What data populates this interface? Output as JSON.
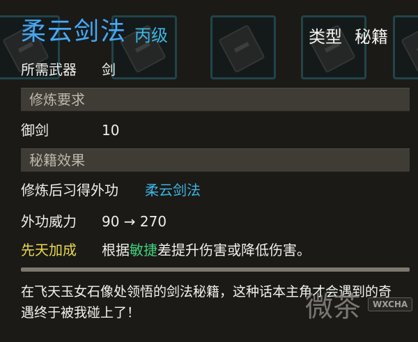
{
  "item": {
    "name": "柔云剑法",
    "grade": "丙级",
    "type_label": "类型",
    "type_value": "秘籍"
  },
  "required_weapon": {
    "label": "所需武器",
    "value": "剑"
  },
  "training_requirements": {
    "header": "修炼要求",
    "rows": [
      {
        "label": "御剑",
        "value": "10"
      }
    ]
  },
  "effects": {
    "header": "秘籍效果",
    "learned": {
      "label": "修炼后习得外功",
      "value": "柔云剑法"
    },
    "power": {
      "label": "外功威力",
      "value": "90 → 270"
    },
    "innate": {
      "label": "先天加成",
      "text_before": "根据",
      "highlight": "敏捷",
      "text_after": "差提升伤害或降低伤害。"
    }
  },
  "description": "在飞天玉女石像处领悟的剑法秘籍，这种话本主角才会遇到的奇遇终于被我碰上了！",
  "watermark": {
    "text": "微茶",
    "tag": "WXCHA"
  },
  "colors": {
    "title": "#4aa8f0",
    "grade": "#3cb6e6",
    "link": "#3cb6e6",
    "innate_label": "#e8d84a",
    "highlight": "#3fd07a",
    "header_bg": "#3f3c36"
  },
  "background_slots": [
    {
      "icon": "book-icon"
    },
    {
      "icon": "book-icon"
    },
    {
      "icon": "book-icon"
    },
    {
      "icon": "book-icon"
    },
    {
      "icon": "book-icon"
    }
  ]
}
